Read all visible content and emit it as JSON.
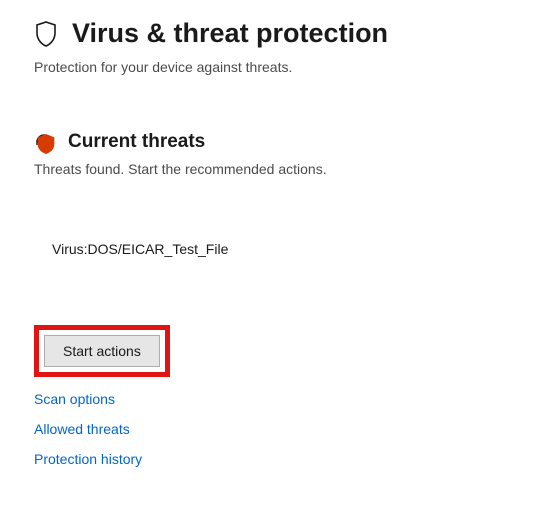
{
  "header": {
    "title": "Virus & threat protection",
    "subtitle": "Protection for your device against threats."
  },
  "section": {
    "title": "Current threats",
    "subtitle": "Threats found. Start the recommended actions."
  },
  "threats": [
    {
      "name": "Virus:DOS/EICAR_Test_File"
    }
  ],
  "actions": {
    "start_label": "Start actions"
  },
  "links": {
    "scan_options": "Scan options",
    "allowed_threats": "Allowed threats",
    "protection_history": "Protection history"
  }
}
